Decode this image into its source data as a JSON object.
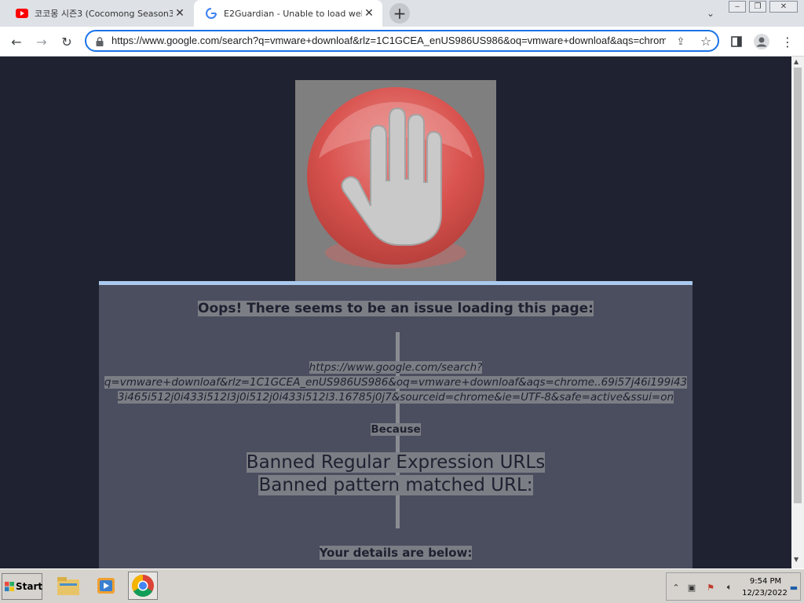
{
  "browser": {
    "tabs": [
      {
        "title": "코코몽 시즌3 (Cocomong Season3) -",
        "favicon": "youtube-icon",
        "active": false
      },
      {
        "title": "E2Guardian - Unable to load website",
        "favicon": "google-icon",
        "active": true
      }
    ],
    "new_tab": "+",
    "url": "https://www.google.com/search?q=vmware+downloaf&rlz=1C1GCEA_enUS986US986&oq=vmware+downloaf&aqs=chrome..69i57j46i199i433i465i512j0i433i512l3j0i512j0i433i512l3.16785j0j7&sourceid=chrome&ie=UTF-8&safe=active&ssui=on"
  },
  "page": {
    "heading": "Oops! There seems to be an issue loading this page:",
    "blocked_url_line1": "https://www.google.com/search?",
    "blocked_url_line2": "q=vmware+downloaf&rlz=1C1GCEA_enUS986US986&oq=vmware+downloaf&aqs=chrome..69i57j46i199i43",
    "blocked_url_line3": "3i465i512j0i433i512l3j0i512j0i433i512l3.16785j0j7&sourceid=chrome&ie=UTF-8&safe=active&ssui=on",
    "because": "Because",
    "reason_line1": "Banned Regular Expression URLs",
    "reason_line2": "Banned pattern matched URL:",
    "details": "Your details are below:"
  },
  "taskbar": {
    "start_label": "Start",
    "apps": [
      "file-explorer-icon",
      "media-player-icon",
      "chrome-icon"
    ],
    "clock_time": "9:54 PM",
    "clock_date": "12/23/2022"
  },
  "colors": {
    "page_background": "#1f2230",
    "panel_background": "#4a4e5f",
    "panel_top_border": "#a9c9ee",
    "stop_sign": "#d9534f"
  }
}
